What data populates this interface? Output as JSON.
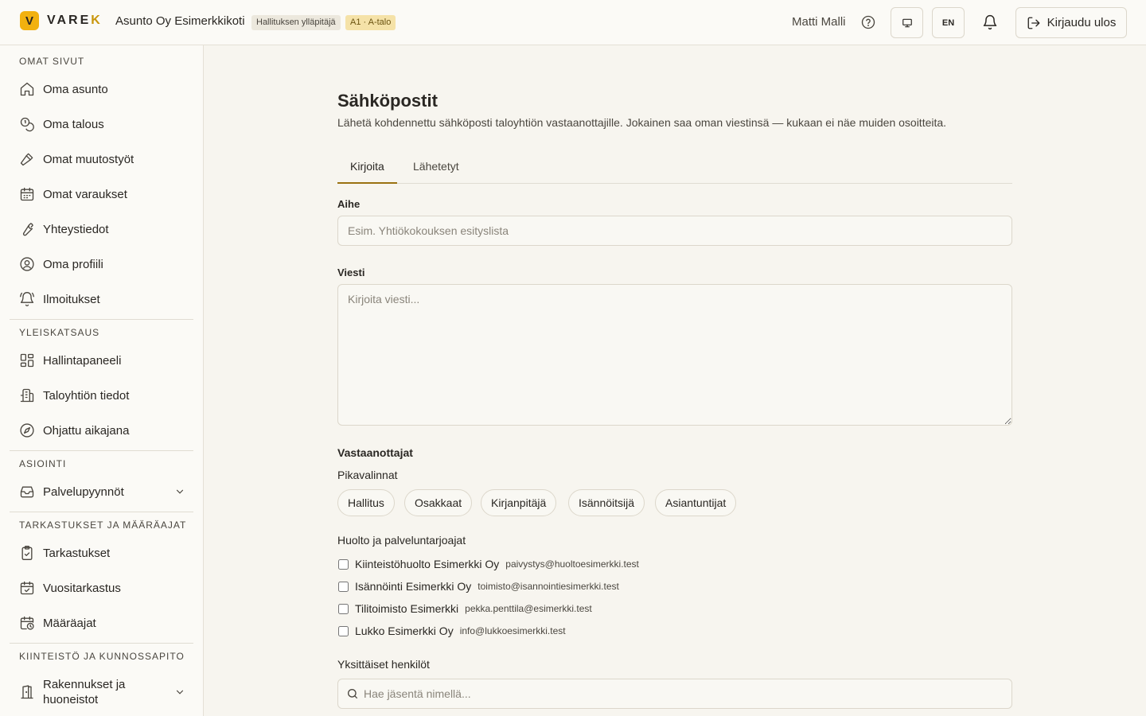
{
  "header": {
    "logo_mark": "V",
    "logo_text_main": "VARE",
    "logo_text_accent": "K",
    "org_name": "Asunto Oy Esimerkkikoti",
    "role_badge": "Hallituksen ylläpitäjä",
    "apartment_badge": "A1 · A-talo",
    "user_name": "Matti Malli",
    "language": "EN",
    "logout_label": "Kirjaudu ulos",
    "icons": [
      "help-icon",
      "monitor-icon",
      "bell-icon",
      "logout-icon"
    ]
  },
  "sidebar": {
    "sections": [
      {
        "title": "OMAT SIVUT",
        "items": [
          {
            "label": "Oma asunto",
            "icon": "home-icon"
          },
          {
            "label": "Oma talous",
            "icon": "coins-icon"
          },
          {
            "label": "Omat muutostyöt",
            "icon": "hammer-icon"
          },
          {
            "label": "Omat varaukset",
            "icon": "calendar-icon"
          },
          {
            "label": "Yhteystiedot",
            "icon": "wrench-icon"
          },
          {
            "label": "Oma profiili",
            "icon": "user-circle-icon"
          },
          {
            "label": "Ilmoitukset",
            "icon": "bell-ring-icon"
          }
        ]
      },
      {
        "title": "YLEISKATSAUS",
        "items": [
          {
            "label": "Hallintapaneeli",
            "icon": "dashboard-icon"
          },
          {
            "label": "Taloyhtiön tiedot",
            "icon": "building-icon"
          },
          {
            "label": "Ohjattu aikajana",
            "icon": "compass-icon"
          }
        ]
      },
      {
        "title": "ASIOINTI",
        "items": [
          {
            "label": "Palvelupyynnöt",
            "icon": "inbox-icon",
            "expandable": true
          }
        ]
      },
      {
        "title": "TARKASTUKSET JA MÄÄRÄAJAT",
        "items": [
          {
            "label": "Tarkastukset",
            "icon": "clipboard-check-icon"
          },
          {
            "label": "Vuositarkastus",
            "icon": "calendar-check-icon"
          },
          {
            "label": "Määräajat",
            "icon": "calendar-clock-icon"
          }
        ]
      },
      {
        "title": "KIINTEISTÖ JA KUNNOSSAPITO",
        "items": [
          {
            "label": "Rakennukset ja huoneistot",
            "icon": "door-icon",
            "expandable": true
          }
        ]
      }
    ]
  },
  "main": {
    "title": "Sähköpostit",
    "description": "Lähetä kohdennettu sähköposti taloyhtiön vastaanottajille. Jokainen saa oman viestinsä — kukaan ei näe muiden osoitteita.",
    "tabs": [
      {
        "label": "Kirjoita",
        "active": true
      },
      {
        "label": "Lähetetyt",
        "active": false
      }
    ],
    "subject": {
      "label": "Aihe",
      "value": "",
      "placeholder": "Esim. Yhtiökokouksen esityslista"
    },
    "message": {
      "label": "Viesti",
      "value": "",
      "placeholder": "Kirjoita viesti..."
    },
    "recipients": {
      "heading": "Vastaanottajat",
      "quick_heading": "Pikavalinnat",
      "quick": [
        "Hallitus",
        "Osakkaat",
        "Kirjanpitäjä",
        "Isännöitsijä",
        "Asiantuntijat"
      ],
      "vendors_heading": "Huolto ja palveluntarjoajat",
      "vendors": [
        {
          "name": "Kiinteistöhuolto Esimerkki Oy",
          "email": "paivystys@huoltoesimerkki.test",
          "checked": false
        },
        {
          "name": "Isännöinti Esimerkki Oy",
          "email": "toimisto@isannointiesimerkki.test",
          "checked": false
        },
        {
          "name": "Tilitoimisto Esimerkki",
          "email": "pekka.penttila@esimerkki.test",
          "checked": false
        },
        {
          "name": "Lukko Esimerkki Oy",
          "email": "info@lukkoesimerkki.test",
          "checked": false
        }
      ],
      "individuals_heading": "Yksittäiset henkilöt",
      "search": {
        "value": "",
        "placeholder": "Hae jäsentä nimellä..."
      }
    }
  },
  "colors": {
    "accent": "#9a7212",
    "logo": "#f2b10f",
    "background": "#f7f5ef",
    "surface": "#fbfaf6",
    "border": "#dcd7cb",
    "apartment_badge_bg": "#f5e2a8"
  }
}
